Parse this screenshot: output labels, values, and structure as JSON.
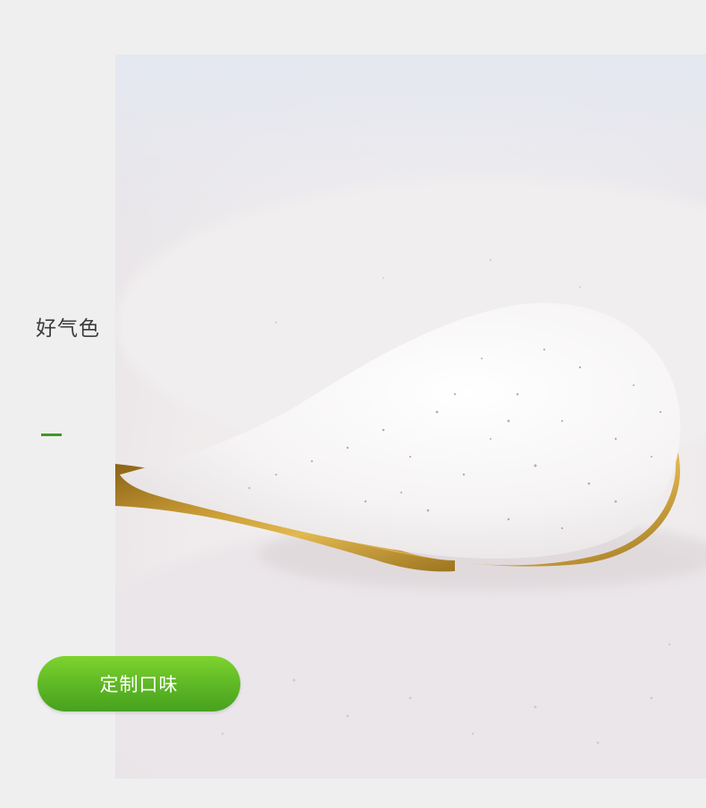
{
  "side_panel": {
    "title": "好气色"
  },
  "cta": {
    "label": "定制口味"
  },
  "colors": {
    "page_background": "#efefef",
    "accent_green": "#3d9a29",
    "button_green_top": "#7ed42e",
    "button_green_bottom": "#47a21e",
    "title_text": "#3c3c3c"
  },
  "photo": {
    "subject": "spoon-of-powder-photo"
  }
}
